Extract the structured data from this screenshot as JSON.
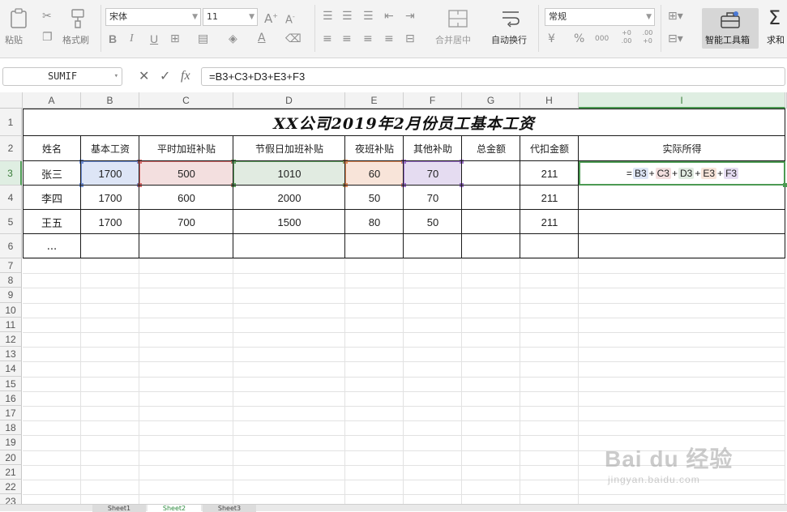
{
  "ribbon": {
    "clipboard": {
      "paste_label": "粘贴",
      "painter_label": "格式刷"
    },
    "font": {
      "family": "宋体",
      "size": "11",
      "bold": "B",
      "italic": "I",
      "underline": "U",
      "font_color_glyph": "A"
    },
    "alignment": {
      "merge_label": "合并居中",
      "wrap_label": "自动换行"
    },
    "number": {
      "format": "常规",
      "percent": "%",
      "thousands": "000",
      "inc_decimal": "+0 .00",
      "dec_decimal": ".00 +0"
    },
    "smart_toolbox_label": "智能工具箱",
    "sum_label": "求和"
  },
  "formula_bar": {
    "name_box": "SUMIF",
    "cancel_glyph": "✕",
    "confirm_glyph": "✓",
    "fx_label": "fx",
    "formula": "=B3+C3+D3+E3+F3"
  },
  "columns": [
    "A",
    "B",
    "C",
    "D",
    "E",
    "F",
    "G",
    "H",
    "I"
  ],
  "rows": [
    "1",
    "2",
    "3",
    "4",
    "5",
    "6",
    "7",
    "8",
    "9",
    "10",
    "11",
    "12",
    "13",
    "14",
    "15",
    "16",
    "17",
    "18",
    "19",
    "20",
    "21",
    "22",
    "23"
  ],
  "sheet": {
    "title": "XX公司2019年2月份员工基本工资",
    "headers": [
      "姓名",
      "基本工资",
      "平时加班补贴",
      "节假日加班补贴",
      "夜班补贴",
      "其他补助",
      "总金额",
      "代扣金额",
      "实际所得"
    ],
    "data_rows": [
      [
        "张三",
        "1700",
        "500",
        "1010",
        "60",
        "70",
        "",
        "211",
        ""
      ],
      [
        "李四",
        "1700",
        "600",
        "2000",
        "50",
        "70",
        "",
        "211",
        ""
      ],
      [
        "王五",
        "1700",
        "700",
        "1500",
        "80",
        "50",
        "",
        "211",
        ""
      ],
      [
        "...",
        "",
        "",
        "",
        "",
        "",
        "",
        "",
        ""
      ]
    ],
    "active_cell_formula_parts": [
      "=",
      "B3",
      "+",
      "C3",
      "+",
      "D3",
      "+",
      "E3",
      "+",
      "F3"
    ]
  },
  "reference_colors": {
    "B3": "#6f8fd6",
    "C3": "#d46a6a",
    "D3": "#5f9e5f",
    "E3": "#e08a58",
    "F3": "#9a6fc9",
    "B3_fill": "#dde5f6",
    "C3_fill": "#f3dfdf",
    "D3_fill": "#e1ebe1",
    "E3_fill": "#f8e4d9",
    "F3_fill": "#e5dcf1",
    "selection": "#4c9a53"
  },
  "tabs": [
    "Sheet1",
    "Sheet2",
    "Sheet3"
  ],
  "watermark": {
    "brand": "Bai du 经验",
    "url": "jingyan.baidu.com"
  }
}
